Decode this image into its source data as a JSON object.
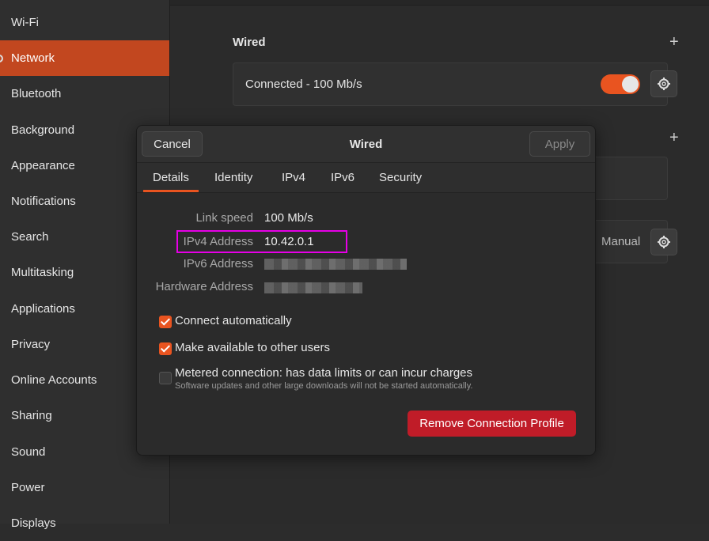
{
  "sidebar": {
    "items": [
      {
        "label": "Wi-Fi"
      },
      {
        "label": "Network"
      },
      {
        "label": "Bluetooth"
      },
      {
        "label": "Background"
      },
      {
        "label": "Appearance"
      },
      {
        "label": "Notifications"
      },
      {
        "label": "Search"
      },
      {
        "label": "Multitasking"
      },
      {
        "label": "Applications"
      },
      {
        "label": "Privacy"
      },
      {
        "label": "Online Accounts"
      },
      {
        "label": "Sharing"
      },
      {
        "label": "Sound"
      },
      {
        "label": "Power"
      },
      {
        "label": "Displays"
      }
    ],
    "active": "Network"
  },
  "main": {
    "wired_title": "Wired",
    "wired_status": "Connected - 100 Mb/s",
    "wired_enabled": true,
    "proxy_value": "Manual"
  },
  "dialog": {
    "title": "Wired",
    "cancel_label": "Cancel",
    "apply_label": "Apply",
    "tabs": [
      {
        "label": "Details"
      },
      {
        "label": "Identity"
      },
      {
        "label": "IPv4"
      },
      {
        "label": "IPv6"
      },
      {
        "label": "Security"
      }
    ],
    "active_tab": "Details",
    "details": {
      "link_speed_label": "Link speed",
      "link_speed": "100 Mb/s",
      "ipv4_label": "IPv4 Address",
      "ipv4": "10.42.0.1",
      "ipv6_label": "IPv6 Address",
      "hardware_label": "Hardware Address"
    },
    "options": {
      "connect_auto": {
        "label": "Connect automatically",
        "checked": true
      },
      "available_all": {
        "label": "Make available to other users",
        "checked": true
      },
      "metered": {
        "label": "Metered connection: has data limits or can incur charges",
        "sublabel": "Software updates and other large downloads will not be started automatically.",
        "checked": false
      }
    },
    "remove_label": "Remove Connection Profile"
  },
  "colors": {
    "accent": "#e95420",
    "sidebar_active": "#c2471f",
    "danger": "#c01c28",
    "highlight": "#e600e6"
  }
}
